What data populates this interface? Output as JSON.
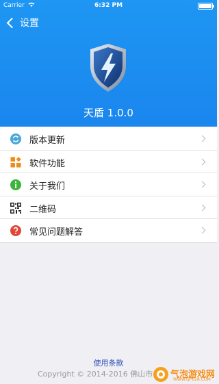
{
  "status_bar": {
    "carrier": "Carrier",
    "time": "6:32 PM",
    "battery_level": 0.9
  },
  "nav": {
    "back_label": "设置"
  },
  "app": {
    "name_version": "天盾 1.0.0"
  },
  "menu": [
    {
      "label": "版本更新",
      "icon": "refresh-icon",
      "color": "#4aa8d8"
    },
    {
      "label": "软件功能",
      "icon": "grid-icon",
      "color": "#f08a1c"
    },
    {
      "label": "关于我们",
      "icon": "info-icon",
      "color": "#3bb53b"
    },
    {
      "label": "二维码",
      "icon": "qr-code-icon",
      "color": "#222222"
    },
    {
      "label": "常见问题解答",
      "icon": "question-icon",
      "color": "#e0463a"
    }
  ],
  "footer": {
    "terms_link": "使用条款",
    "copyright": "Copyright © 2014-2016 佛山市"
  },
  "watermark": {
    "text": "气泡游戏网",
    "url": "WWW.QP628.COM"
  },
  "colors": {
    "header": "#1a8cf0",
    "link": "#2a4fb8"
  }
}
